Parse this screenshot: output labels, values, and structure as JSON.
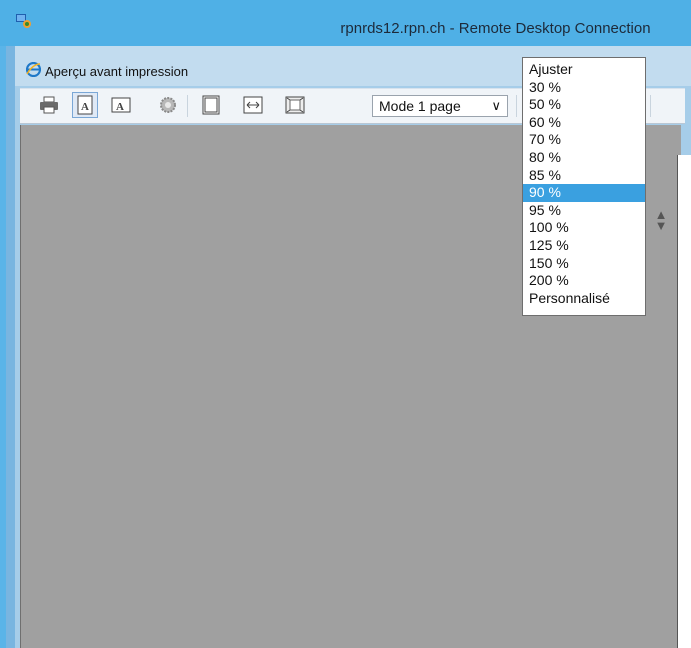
{
  "rdp": {
    "title": "rpnrds12.rpn.ch - Remote Desktop Connection"
  },
  "window": {
    "title": "Aperçu avant impression"
  },
  "toolbar": {
    "mode_select_value": "Mode 1 page",
    "icons": [
      "print-icon",
      "portrait-icon",
      "landscape-icon",
      "page-setup-gear-icon",
      "full-page-icon",
      "page-width-icon",
      "shrink-to-fit-icon"
    ]
  },
  "dropdown": {
    "items": [
      "Ajuster",
      "30 %",
      "50 %",
      "60 %",
      "70 %",
      "80 %",
      "85 %",
      "90 %",
      "95 %",
      "100 %",
      "125 %",
      "150 %",
      "200 %",
      "Personnalisé"
    ],
    "selected": "90 %"
  },
  "colors": {
    "rdp_titlebar": "#4fb0e6",
    "selection": "#3aa0e0",
    "preview_bg": "#a0a0a0"
  }
}
